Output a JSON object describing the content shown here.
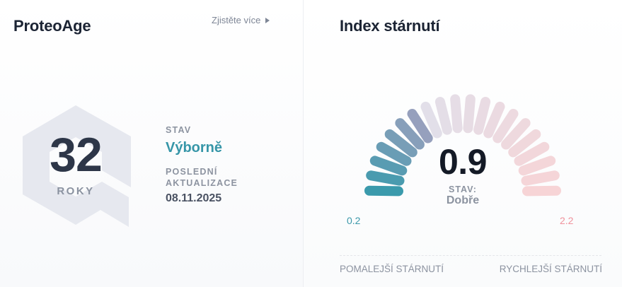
{
  "proteo_age": {
    "title": "ProteoAge",
    "learn_more_label": "Zjistěte více",
    "age_value": "32",
    "age_unit": "ROKY",
    "status_label": "STAV",
    "status_value": "Výborně",
    "last_update_label": "POSLEDNÍ AKTUALIZACE",
    "last_update_value": "08.11.2025"
  },
  "aging_index": {
    "title": "Index stárnutí",
    "value": "0.9",
    "status_label": "STAV:",
    "status_value": "Dobře",
    "gauge_min": "0.2",
    "gauge_max": "2.2",
    "gauge_min_value": 0.2,
    "gauge_max_value": 2.2,
    "gauge_current_value": 0.9,
    "segment_count": 20,
    "legend_slower": "POMALEJŠÍ STÁRNUTÍ",
    "legend_faster": "RYCHLEJŠÍ STÁRNUTÍ"
  },
  "colors": {
    "accent_teal": "#3696a8",
    "gauge_start": "#3b9aac",
    "gauge_mid": "#96a0bd",
    "gauge_inactive_start": "#e2dfe9",
    "gauge_inactive_end": "#f7d4d6",
    "max_pink": "#f0929c",
    "badge_shape": "#e6e8ef"
  }
}
